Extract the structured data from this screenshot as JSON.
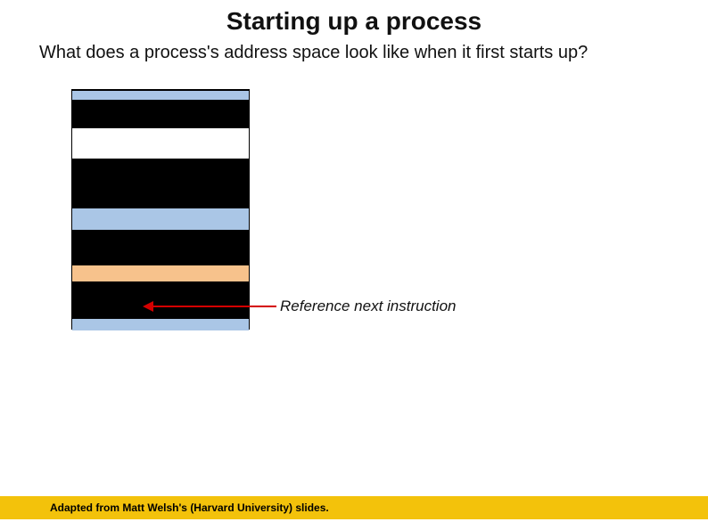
{
  "title": "Starting up a process",
  "subtitle": "What does a process's address space look like when it first starts up?",
  "reference_label": "Reference next instruction",
  "footer": "Adapted from Matt Welsh's (Harvard University) slides.",
  "colors": {
    "blue": "#aac6e6",
    "orange": "#f7c28c",
    "black": "#000000",
    "footer_bar": "#f3c20b",
    "arrow_red": "#d40000"
  },
  "diagram": {
    "segments": [
      {
        "name": "top-thin-blue",
        "color": "blue"
      },
      {
        "name": "black-1",
        "color": "black"
      },
      {
        "name": "gap-grow-arrows",
        "color": "white"
      },
      {
        "name": "black-2",
        "color": "black"
      },
      {
        "name": "blue-mid",
        "color": "blue"
      },
      {
        "name": "black-3",
        "color": "black"
      },
      {
        "name": "orange-band",
        "color": "orange"
      },
      {
        "name": "black-4",
        "color": "black"
      },
      {
        "name": "bottom-thin-blue",
        "color": "blue"
      }
    ]
  }
}
